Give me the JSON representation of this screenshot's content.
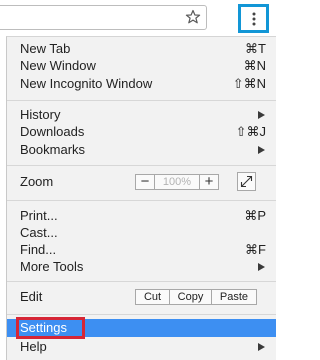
{
  "menu": {
    "new_tab": {
      "label": "New Tab",
      "shortcut": "⌘T"
    },
    "new_window": {
      "label": "New Window",
      "shortcut": "⌘N"
    },
    "new_incognito": {
      "label": "New Incognito Window",
      "shortcut": "⇧⌘N"
    },
    "history": {
      "label": "History"
    },
    "downloads": {
      "label": "Downloads",
      "shortcut": "⇧⌘J"
    },
    "bookmarks": {
      "label": "Bookmarks"
    },
    "zoom": {
      "label": "Zoom",
      "minus": "−",
      "level": "100%",
      "plus": "+"
    },
    "print": {
      "label": "Print...",
      "shortcut": "⌘P"
    },
    "cast": {
      "label": "Cast..."
    },
    "find": {
      "label": "Find...",
      "shortcut": "⌘F"
    },
    "more_tools": {
      "label": "More Tools"
    },
    "edit": {
      "label": "Edit",
      "cut": "Cut",
      "copy": "Copy",
      "paste": "Paste"
    },
    "settings": {
      "label": "Settings"
    },
    "help": {
      "label": "Help"
    }
  },
  "colors": {
    "menu_background": "#f2f2f2",
    "highlight": "#3d8ff2",
    "menu_button_outline": "#1296d6",
    "settings_outline": "#d62636"
  },
  "icons": {
    "bookmark_star": "star-icon",
    "menu_button": "kebab-icon",
    "fullscreen": "fullscreen-icon",
    "submenu": "submenu-arrow-icon"
  }
}
